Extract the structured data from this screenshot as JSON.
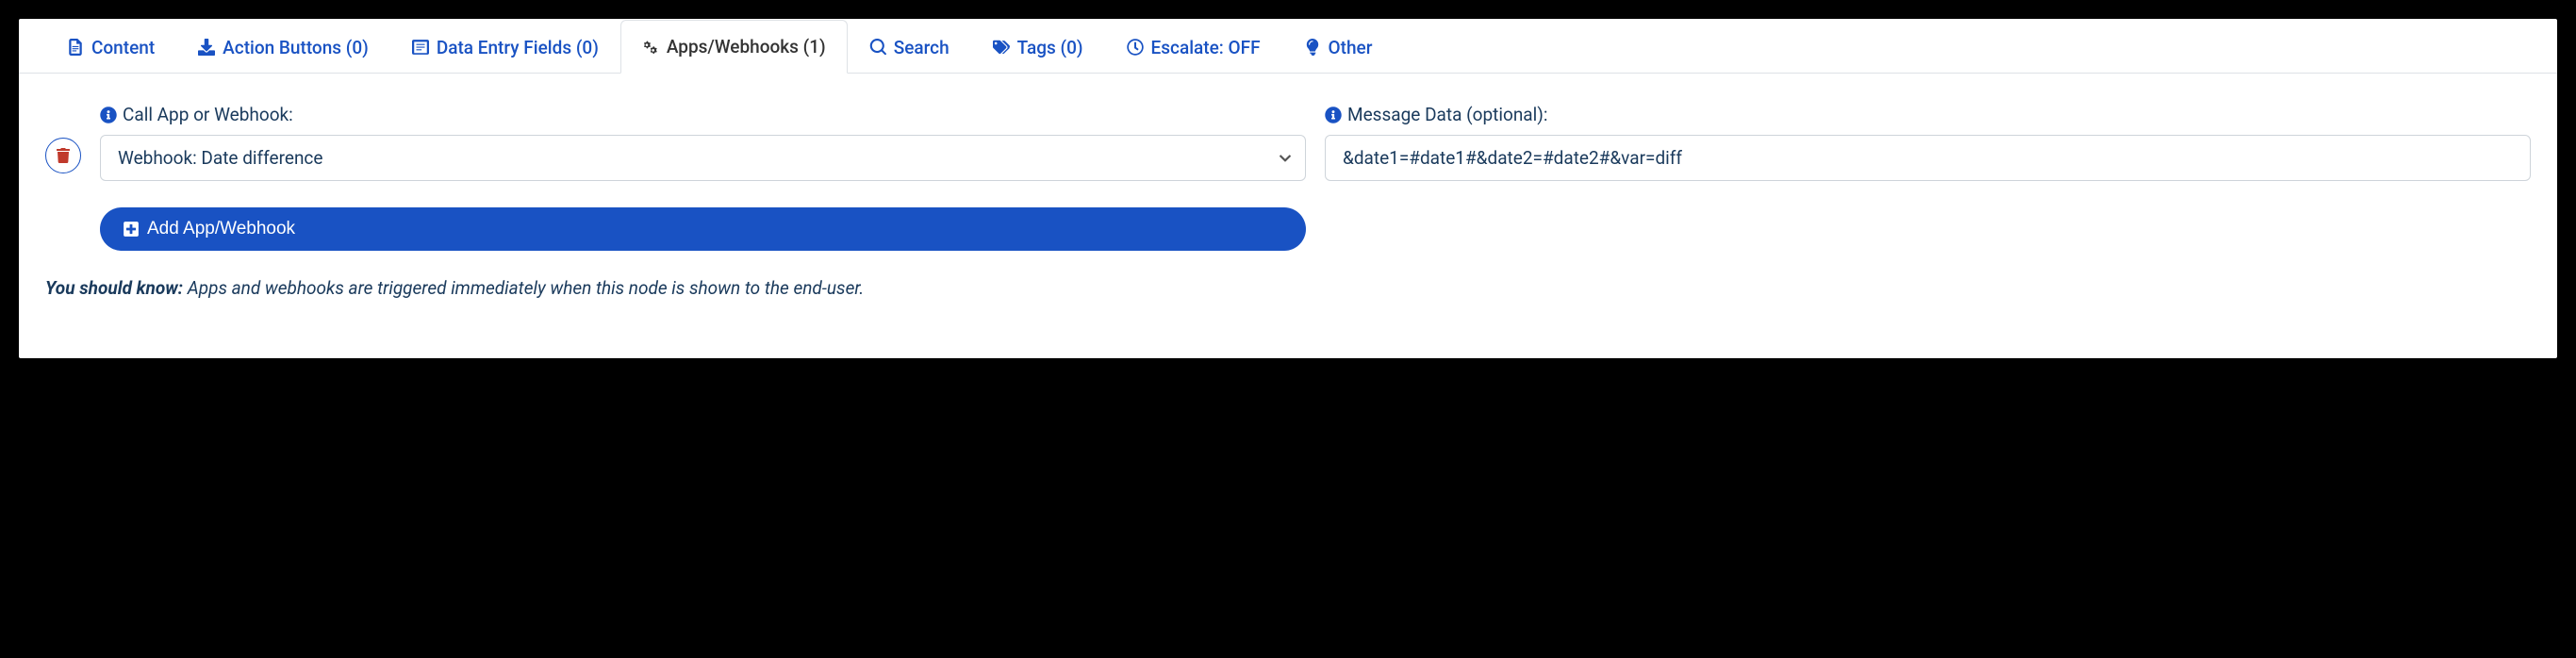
{
  "tabs": {
    "content": "Content",
    "action_buttons": "Action Buttons (0)",
    "data_entry": "Data Entry Fields (0)",
    "apps_webhooks": "Apps/Webhooks (1)",
    "search": "Search",
    "tags": "Tags (0)",
    "escalate": "Escalate: OFF",
    "other": "Other"
  },
  "form": {
    "call_label": "Call App or Webhook:",
    "webhook_select": "Webhook:  Date difference",
    "message_label": "Message Data (optional):",
    "message_value": "&date1=#date1#&date2=#date2#&var=diff",
    "add_button": "Add App/Webhook"
  },
  "note": {
    "prefix": "You should know:",
    "text": " Apps and webhooks are triggered immediately when this node is shown to the end-user."
  }
}
